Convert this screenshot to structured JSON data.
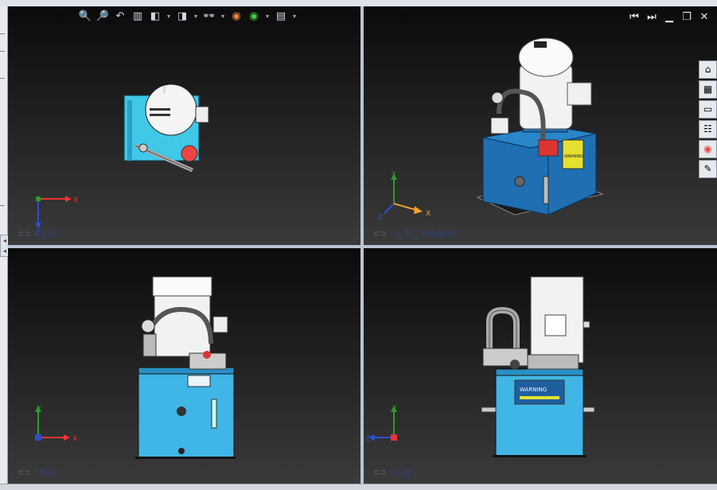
{
  "viewports": {
    "top": {
      "label": "*上视",
      "link_icon": "link-icon"
    },
    "iso": {
      "label": "*上下二等角轴测",
      "link_icon": "link-icon"
    },
    "front": {
      "label": "*前视",
      "link_icon": "link-icon"
    },
    "right": {
      "label": "*右视",
      "link_icon": "link-icon"
    }
  },
  "toolbar": {
    "icons": [
      "zoom-to-fit-icon",
      "zoom-area-icon",
      "previous-view-icon",
      "section-view-icon",
      "view-orientation-icon",
      "display-style-icon",
      "hide-show-icon",
      "edit-appearance-icon",
      "apply-scene-icon",
      "view-settings-icon"
    ]
  },
  "window_controls": [
    "previous-viewport-icon",
    "next-viewport-icon",
    "minimize-icon",
    "restore-icon",
    "close-icon"
  ],
  "task_pane": [
    "home-icon",
    "design-library-icon",
    "file-explorer-icon",
    "view-palette-icon",
    "appearances-icon",
    "custom-properties-icon"
  ],
  "triad": {
    "x": "X",
    "y": "Y",
    "z": "Z"
  },
  "model_text": {
    "warning": "WARNING"
  },
  "colors": {
    "tank": "#3fb6e6",
    "tank_dark": "#1f6fb2",
    "motor": "#f2f2f2",
    "axis_x": "#e33",
    "axis_y": "#2c9b2c",
    "axis_z": "#2b4fd0",
    "axis_x_iso": "#f0a030"
  }
}
